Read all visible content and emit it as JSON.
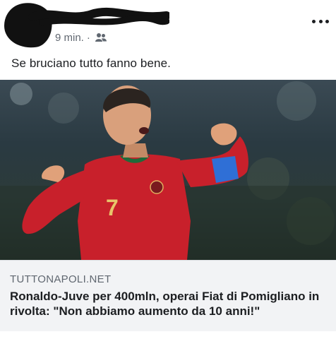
{
  "post": {
    "time": "9 min.",
    "separator": "·",
    "audience_icon": "friends-icon",
    "text": "Se bruciano tutto fanno bene.",
    "more_icon": "more-dots-icon"
  },
  "link_card": {
    "domain": "TUTTONAPOLI.NET",
    "title": "Ronaldo-Juve per 400mln, operai Fiat di Pomigliano in rivolta: \"Non abbiamo aumento da 10 anni!\"",
    "jersey_number": "7"
  },
  "colors": {
    "text_primary": "#1c1e21",
    "text_secondary": "#606770",
    "card_background": "#f2f3f5",
    "jersey_red": "#c8202b",
    "armband_blue": "#2f6fd6"
  }
}
